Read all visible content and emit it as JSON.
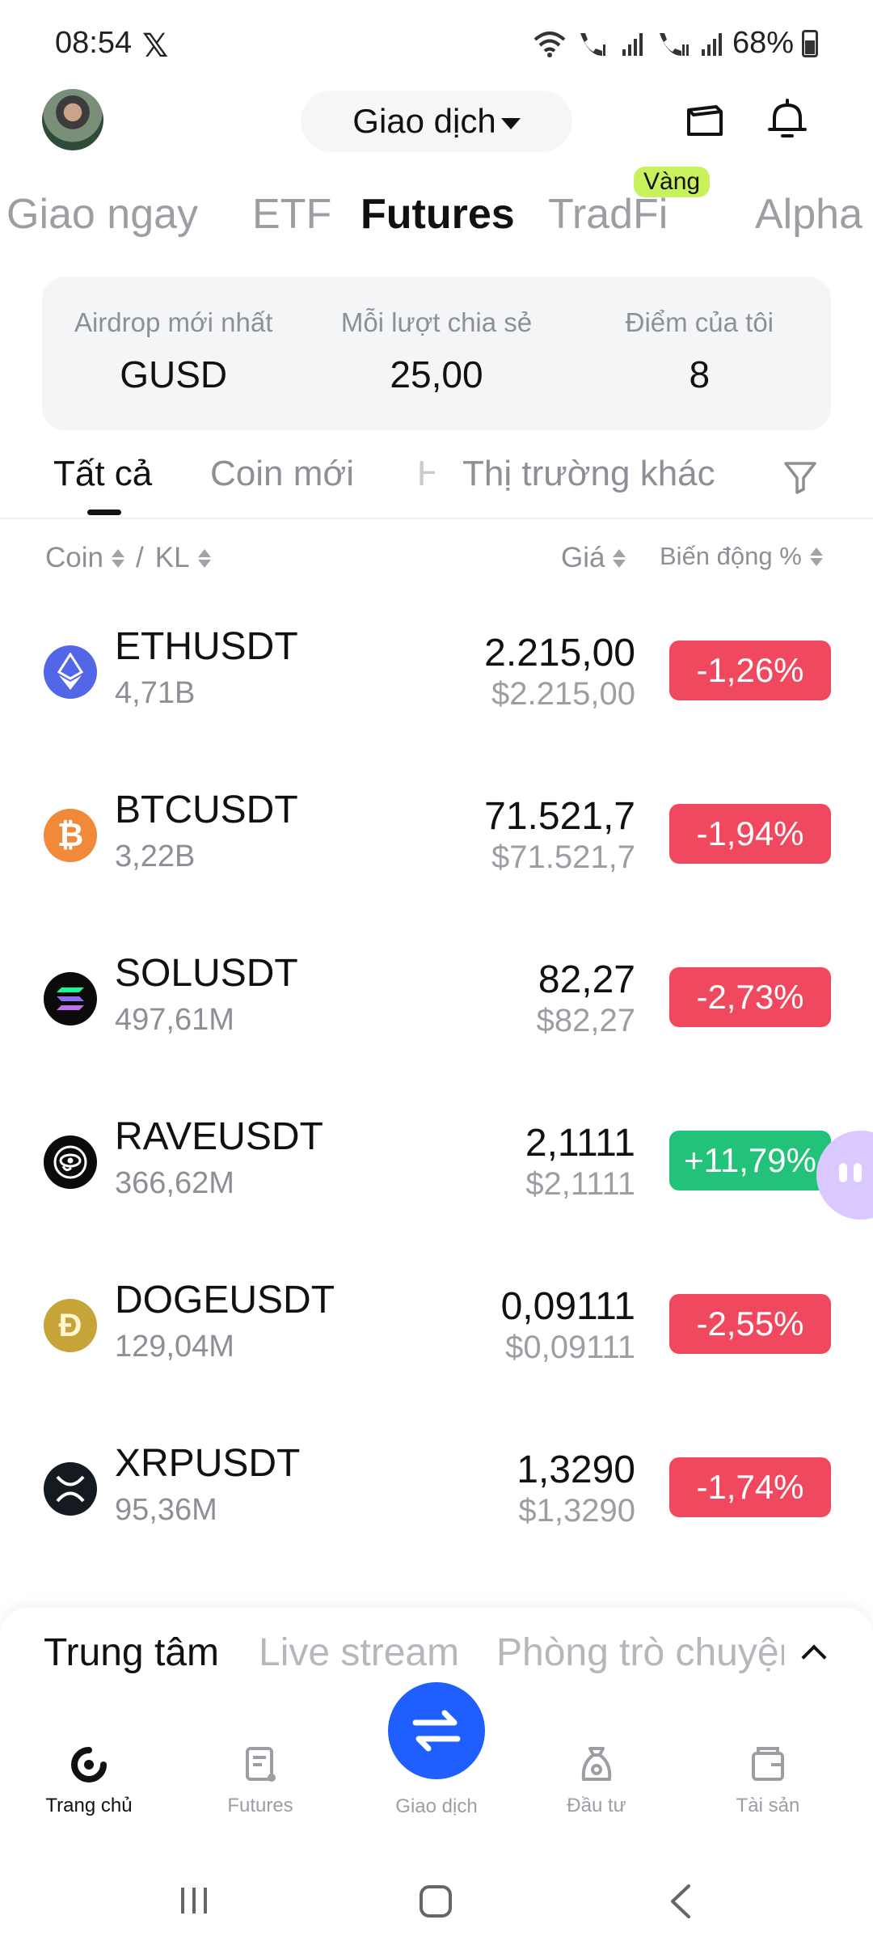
{
  "status_bar": {
    "time": "08:54",
    "battery": "68%"
  },
  "header": {
    "title": "Giao dịch"
  },
  "category_tabs": [
    {
      "label": "Giao ngay"
    },
    {
      "label": "ETF"
    },
    {
      "label": "Futures"
    },
    {
      "label": "TradFi",
      "badge": "Vàng"
    },
    {
      "label": "Alpha"
    }
  ],
  "airdrop": [
    {
      "label": "Airdrop mới nhất",
      "value": "GUSD"
    },
    {
      "label": "Mỗi lượt chia sẻ",
      "value": "25,00"
    },
    {
      "label": "Điểm của tôi",
      "value": "8"
    }
  ],
  "sub_tabs": [
    {
      "label": "Tất cả"
    },
    {
      "label": "Coin mới"
    },
    {
      "label": "H"
    },
    {
      "label": "Thị trường khác"
    }
  ],
  "columns": {
    "coin": "Coin",
    "sep": "/",
    "volume": "KL",
    "price": "Giá",
    "change": "Biến động %"
  },
  "rows": [
    {
      "symbol": "ETHUSDT",
      "volume": "4,71B",
      "price": "2.215,00",
      "price_usd": "$2.215,00",
      "change": "-1,26%"
    },
    {
      "symbol": "BTCUSDT",
      "volume": "3,22B",
      "price": "71.521,7",
      "price_usd": "$71.521,7",
      "change": "-1,94%"
    },
    {
      "symbol": "SOLUSDT",
      "volume": "497,61M",
      "price": "82,27",
      "price_usd": "$82,27",
      "change": "-2,73%"
    },
    {
      "symbol": "RAVEUSDT",
      "volume": "366,62M",
      "price": "2,1111",
      "price_usd": "$2,1111",
      "change": "+11,79%"
    },
    {
      "symbol": "DOGEUSDT",
      "volume": "129,04M",
      "price": "0,09111",
      "price_usd": "$0,09111",
      "change": "-2,55%"
    },
    {
      "symbol": "XRPUSDT",
      "volume": "95,36M",
      "price": "1,3290",
      "price_usd": "$1,3290",
      "change": "-1,74%"
    }
  ],
  "colors": {
    "down": "#f0485e",
    "up": "#22c27a",
    "accent": "#1f5eff",
    "badge": "#c8f25c"
  },
  "feed_tabs": [
    {
      "label": "Trung tâm"
    },
    {
      "label": "Live stream"
    },
    {
      "label": "Phòng trò chuyện"
    }
  ],
  "bottom_nav": [
    {
      "label": "Trang chủ",
      "icon": "home-icon"
    },
    {
      "label": "Futures",
      "icon": "futures-icon"
    },
    {
      "label": "Giao dịch",
      "icon": "swap-icon"
    },
    {
      "label": "Đầu tư",
      "icon": "invest-icon"
    },
    {
      "label": "Tài sản",
      "icon": "wallet-icon"
    }
  ]
}
